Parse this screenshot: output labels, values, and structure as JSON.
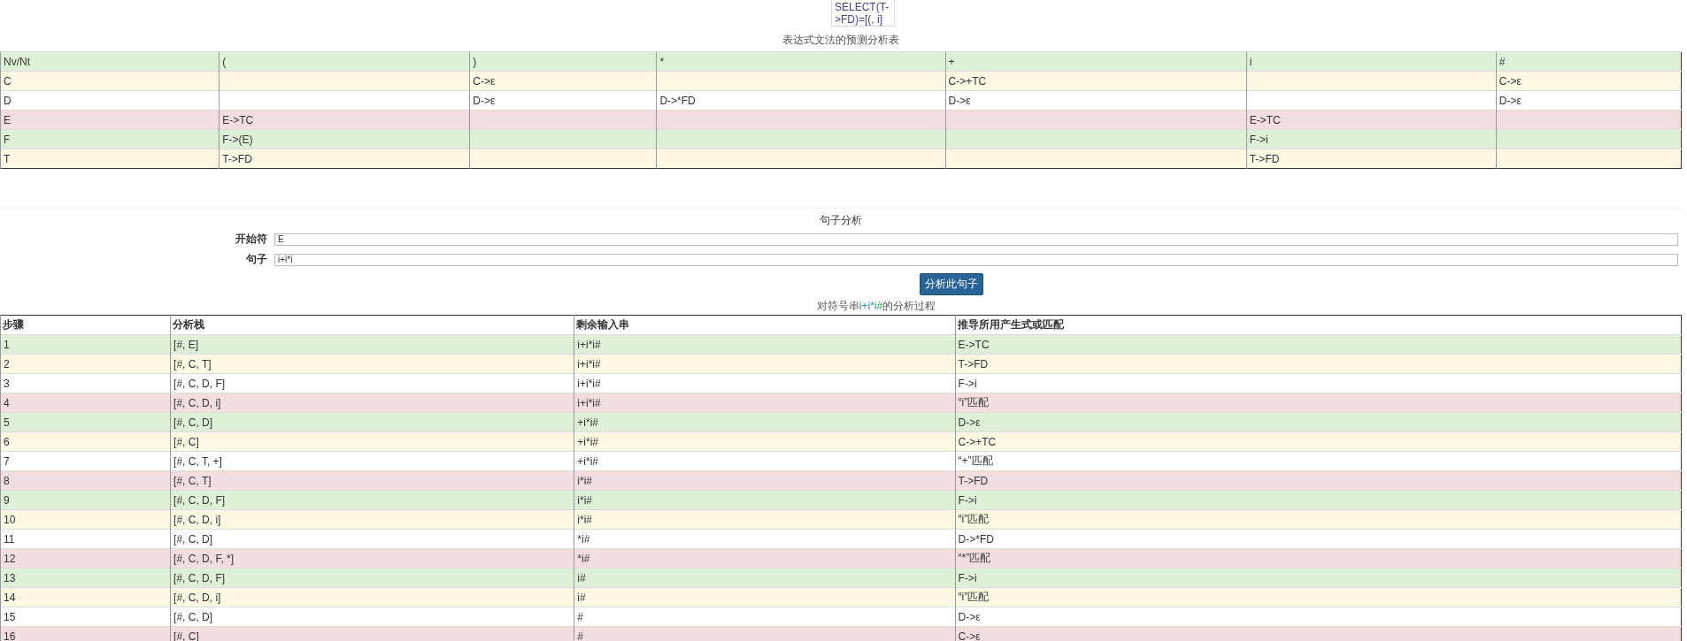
{
  "tooltip": {
    "lines": [
      "SELECT(T-",
      ">FD)=[(, i]"
    ]
  },
  "predict_table": {
    "title": "表达式文法的预测分析表",
    "columns": [
      "Nv/Nt",
      "(",
      ")",
      "*",
      "+",
      "i",
      "#"
    ],
    "rows": [
      {
        "color": "#fcf8e3",
        "cells": [
          "C",
          "",
          "C->ε",
          "",
          "C->+TC",
          "",
          "C->ε"
        ]
      },
      {
        "color": "#ffffff",
        "cells": [
          "D",
          "",
          "D->ε",
          "D->*FD",
          "D->ε",
          "",
          "D->ε"
        ]
      },
      {
        "color": "#f2dede",
        "cells": [
          "E",
          "E->TC",
          "",
          "",
          "",
          "E->TC",
          ""
        ]
      },
      {
        "color": "#dff0d8",
        "cells": [
          "F",
          "F->(E)",
          "",
          "",
          "",
          "F->i",
          ""
        ]
      },
      {
        "color": "#fcf8e3",
        "cells": [
          "T",
          "T->FD",
          "",
          "",
          "",
          "T->FD",
          ""
        ]
      }
    ]
  },
  "sentence_form": {
    "title": "句子分析",
    "fields": [
      {
        "label": "开始符",
        "value": "E"
      },
      {
        "label": "句子",
        "value": "i+i*i"
      }
    ],
    "button": "分析此句子"
  },
  "analysis_table": {
    "caption": {
      "before": "对符号串",
      "symbols": "i+i*i",
      "end": "#",
      "after": "的分析过程"
    },
    "columns": [
      "步骤",
      "分析栈",
      "剩余输入串",
      "推导所用产生式或匹配"
    ],
    "rows": [
      {
        "color": "#dff0d8",
        "cells": [
          "1",
          "[#, E]",
          "i+i*i#",
          "E->TC"
        ]
      },
      {
        "color": "#fcf8e3",
        "cells": [
          "2",
          "[#, C, T]",
          "i+i*i#",
          "T->FD"
        ]
      },
      {
        "color": "#ffffff",
        "cells": [
          "3",
          "[#, C, D, F]",
          "i+i*i#",
          "F->i"
        ]
      },
      {
        "color": "#f2dede",
        "cells": [
          "4",
          "[#, C, D, i]",
          "i+i*i#",
          "“i”匹配"
        ]
      },
      {
        "color": "#dff0d8",
        "cells": [
          "5",
          "[#, C, D]",
          "+i*i#",
          "D->ε"
        ]
      },
      {
        "color": "#fcf8e3",
        "cells": [
          "6",
          "[#, C]",
          "+i*i#",
          "C->+TC"
        ]
      },
      {
        "color": "#ffffff",
        "cells": [
          "7",
          "[#, C, T, +]",
          "+i*i#",
          "“+”匹配"
        ]
      },
      {
        "color": "#f2dede",
        "cells": [
          "8",
          "[#, C, T]",
          "i*i#",
          "T->FD"
        ]
      },
      {
        "color": "#dff0d8",
        "cells": [
          "9",
          "[#, C, D, F]",
          "i*i#",
          "F->i"
        ]
      },
      {
        "color": "#fcf8e3",
        "cells": [
          "10",
          "[#, C, D, i]",
          "i*i#",
          "“i”匹配"
        ]
      },
      {
        "color": "#ffffff",
        "cells": [
          "11",
          "[#, C, D]",
          "*i#",
          "D->*FD"
        ]
      },
      {
        "color": "#f2dede",
        "cells": [
          "12",
          "[#, C, D, F, *]",
          "*i#",
          "“*”匹配"
        ]
      },
      {
        "color": "#dff0d8",
        "cells": [
          "13",
          "[#, C, D, F]",
          "i#",
          "F->i"
        ]
      },
      {
        "color": "#fcf8e3",
        "cells": [
          "14",
          "[#, C, D, i]",
          "i#",
          "“i”匹配"
        ]
      },
      {
        "color": "#ffffff",
        "cells": [
          "15",
          "[#, C, D]",
          "#",
          "D->ε"
        ]
      },
      {
        "color": "#f2dede",
        "cells": [
          "16",
          "[#, C]",
          "#",
          "C->ε"
        ]
      }
    ]
  }
}
